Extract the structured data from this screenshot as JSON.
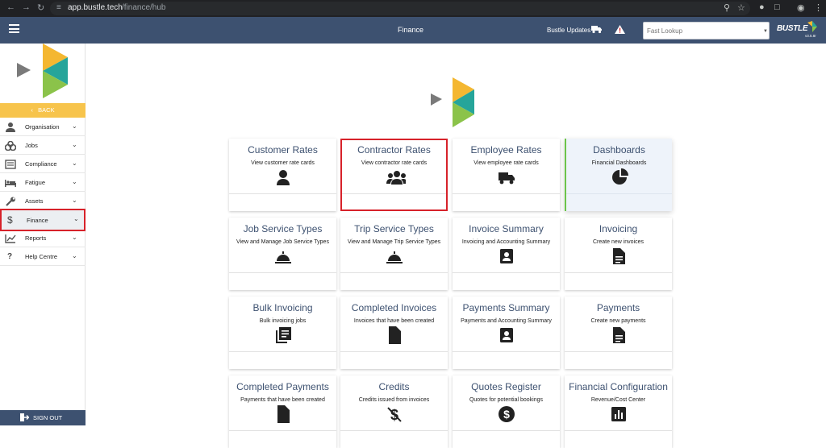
{
  "browser": {
    "url_host": "app.bustle.tech",
    "url_path": "/finance/hub"
  },
  "header": {
    "title": "Finance",
    "updates_label": "Bustle Updates",
    "lookup_placeholder": "Fast Lookup",
    "brand": "BUSTLE",
    "version": "v3.5.8r"
  },
  "sidebar": {
    "back_label": "BACK",
    "items": [
      {
        "label": "Organisation",
        "icon": "person-icon"
      },
      {
        "label": "Jobs",
        "icon": "boxes-icon"
      },
      {
        "label": "Compliance",
        "icon": "id-card-icon"
      },
      {
        "label": "Fatigue",
        "icon": "bed-icon"
      },
      {
        "label": "Assets",
        "icon": "wrench-icon"
      },
      {
        "label": "Finance",
        "icon": "dollar-icon"
      },
      {
        "label": "Reports",
        "icon": "chart-line-icon"
      },
      {
        "label": "Help Centre",
        "icon": "question-icon"
      }
    ],
    "active": "Finance",
    "signout_label": "SIGN OUT"
  },
  "tiles": [
    {
      "title": "Customer Rates",
      "subtitle": "View customer rate cards",
      "icon": "user-icon"
    },
    {
      "title": "Contractor Rates",
      "subtitle": "View contractor rate cards",
      "icon": "users-icon"
    },
    {
      "title": "Employee Rates",
      "subtitle": "View employee rate cards",
      "icon": "truck-icon"
    },
    {
      "title": "Dashboards",
      "subtitle": "Financial Dashboards",
      "icon": "pie-chart-icon"
    },
    {
      "title": "Job Service Types",
      "subtitle": "View and Manage Job Service Types",
      "icon": "bell-service-icon"
    },
    {
      "title": "Trip Service Types",
      "subtitle": "View and Manage Trip Service Types",
      "icon": "bell-service-icon"
    },
    {
      "title": "Invoice Summary",
      "subtitle": "Invoicing and Accounting Summary",
      "icon": "contact-card-icon"
    },
    {
      "title": "Invoicing",
      "subtitle": "Create new invoices",
      "icon": "document-icon"
    },
    {
      "title": "Bulk Invoicing",
      "subtitle": "Bulk invoicing jobs",
      "icon": "stacked-documents-icon"
    },
    {
      "title": "Completed Invoices",
      "subtitle": "Invoices that have been created",
      "icon": "file-icon"
    },
    {
      "title": "Payments Summary",
      "subtitle": "Payments and Accounting Summary",
      "icon": "contact-card-icon"
    },
    {
      "title": "Payments",
      "subtitle": "Create new payments",
      "icon": "document-icon"
    },
    {
      "title": "Completed Payments",
      "subtitle": "Payments that have been created",
      "icon": "file-icon"
    },
    {
      "title": "Credits",
      "subtitle": "Credits issued from invoices",
      "icon": "dollar-off-icon"
    },
    {
      "title": "Quotes Register",
      "subtitle": "Quotes for potential bookings",
      "icon": "dollar-circle-icon"
    },
    {
      "title": "Financial Configuration",
      "subtitle": "Revenue/Cost Center",
      "icon": "bar-chart-icon"
    }
  ],
  "colors": {
    "header": "#3d5170",
    "accent_yellow": "#f7c44c",
    "highlight": "#d7222a",
    "logo_yellow": "#f4b731",
    "logo_teal": "#26a59a",
    "logo_green": "#8bc34a",
    "logo_grey": "#7a7a7a"
  }
}
